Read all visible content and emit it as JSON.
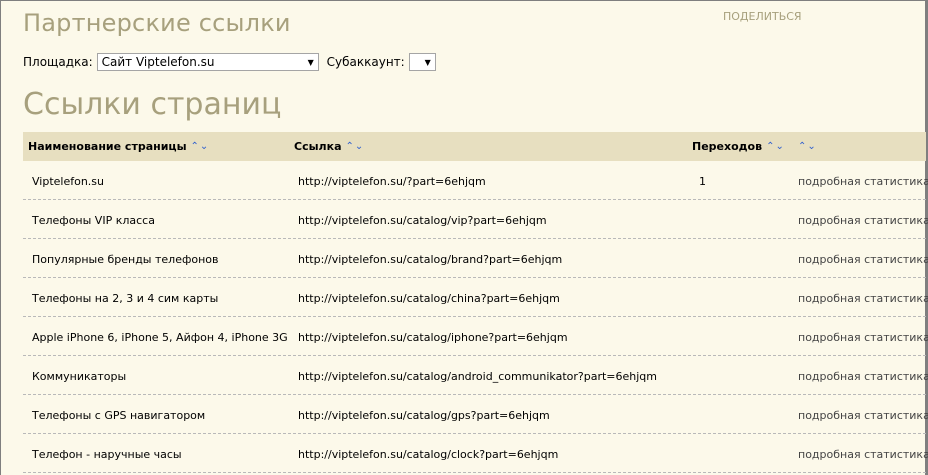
{
  "header": {
    "title": "Партнерские ссылки",
    "share": "ПОДЕЛИТЬСЯ"
  },
  "filters": {
    "platform_label": "Площадка:",
    "platform_value": "Сайт Viptelefon.su",
    "subaccount_label": "Субаккаунт:",
    "subaccount_value": ""
  },
  "section": {
    "title": "Ссылки страниц"
  },
  "table": {
    "columns": {
      "name": "Наименование страницы",
      "url": "Ссылка",
      "hits": "Переходов",
      "extra": ""
    },
    "sort_glyph": "^v",
    "rows": [
      {
        "name": "Viptelefon.su",
        "url": "http://viptelefon.su/?part=6ehjqm",
        "hits": "1",
        "stat": "подробная статистика"
      },
      {
        "name": "Телефоны VIP класса",
        "url": "http://viptelefon.su/catalog/vip?part=6ehjqm",
        "hits": "",
        "stat": "подробная статистика"
      },
      {
        "name": "Популярные бренды телефонов",
        "url": "http://viptelefon.su/catalog/brand?part=6ehjqm",
        "hits": "",
        "stat": "подробная статистика"
      },
      {
        "name": "Телефоны на 2, 3 и 4 сим карты",
        "url": "http://viptelefon.su/catalog/china?part=6ehjqm",
        "hits": "",
        "stat": "подробная статистика"
      },
      {
        "name": "Apple iPhone 6, iPhone 5, Айфон 4, iPhone 3G",
        "url": "http://viptelefon.su/catalog/iphone?part=6ehjqm",
        "hits": "",
        "stat": "подробная статистика"
      },
      {
        "name": "Коммуникаторы",
        "url": "http://viptelefon.su/catalog/android_communikator?part=6ehjqm",
        "hits": "",
        "stat": "подробная статистика"
      },
      {
        "name": "Телефоны с GPS навигатором",
        "url": "http://viptelefon.su/catalog/gps?part=6ehjqm",
        "hits": "",
        "stat": "подробная статистика"
      },
      {
        "name": "Телефон - наручные часы",
        "url": "http://viptelefon.su/catalog/clock?part=6ehjqm",
        "hits": "",
        "stat": "подробная статистика"
      }
    ]
  }
}
